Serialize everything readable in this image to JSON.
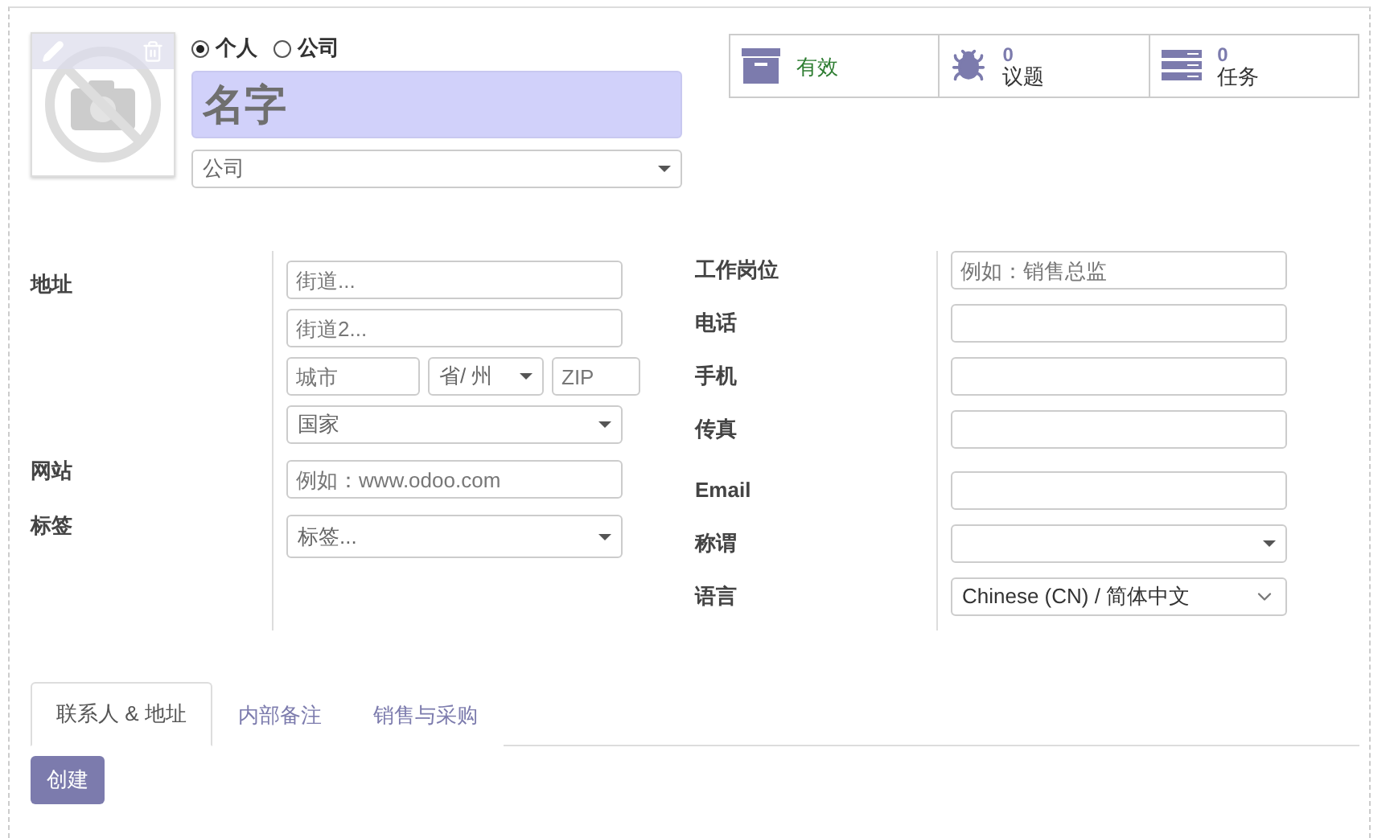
{
  "company_type": [
    {
      "label": "个人",
      "selected": true
    },
    {
      "label": "公司",
      "selected": false
    }
  ],
  "name_field": {
    "placeholder": "名字"
  },
  "company_select": {
    "placeholder": "公司"
  },
  "stat_buttons": [
    {
      "kind": "archive",
      "label": "有效"
    },
    {
      "kind": "bug",
      "count": "0",
      "label": "议题"
    },
    {
      "kind": "tasks",
      "count": "0",
      "label": "任务"
    }
  ],
  "address": {
    "label": "地址",
    "street": {
      "placeholder": "街道..."
    },
    "street2": {
      "placeholder": "街道2..."
    },
    "city": {
      "placeholder": "城市"
    },
    "state": {
      "placeholder": "省/ 州"
    },
    "zip": {
      "placeholder": "ZIP"
    },
    "country": {
      "placeholder": "国家"
    }
  },
  "website": {
    "label": "网站",
    "placeholder": "例如：www.odoo.com"
  },
  "tags": {
    "label": "标签",
    "placeholder": "标签..."
  },
  "right_fields": [
    {
      "label": "工作岗位",
      "kind": "text",
      "placeholder": "例如：销售总监"
    },
    {
      "label": "电话",
      "kind": "text"
    },
    {
      "label": "手机",
      "kind": "text"
    },
    {
      "label": "传真",
      "kind": "text"
    },
    {
      "label": "Email",
      "kind": "text"
    },
    {
      "label": "称谓",
      "kind": "select"
    },
    {
      "label": "语言",
      "kind": "native_select",
      "value": "Chinese (CN) / 简体中文"
    }
  ],
  "tabs": [
    {
      "label": "联系人 & 地址",
      "selected": true
    },
    {
      "label": "内部备注",
      "selected": false
    },
    {
      "label": "销售与采购",
      "selected": false
    }
  ],
  "create_button": "创建"
}
